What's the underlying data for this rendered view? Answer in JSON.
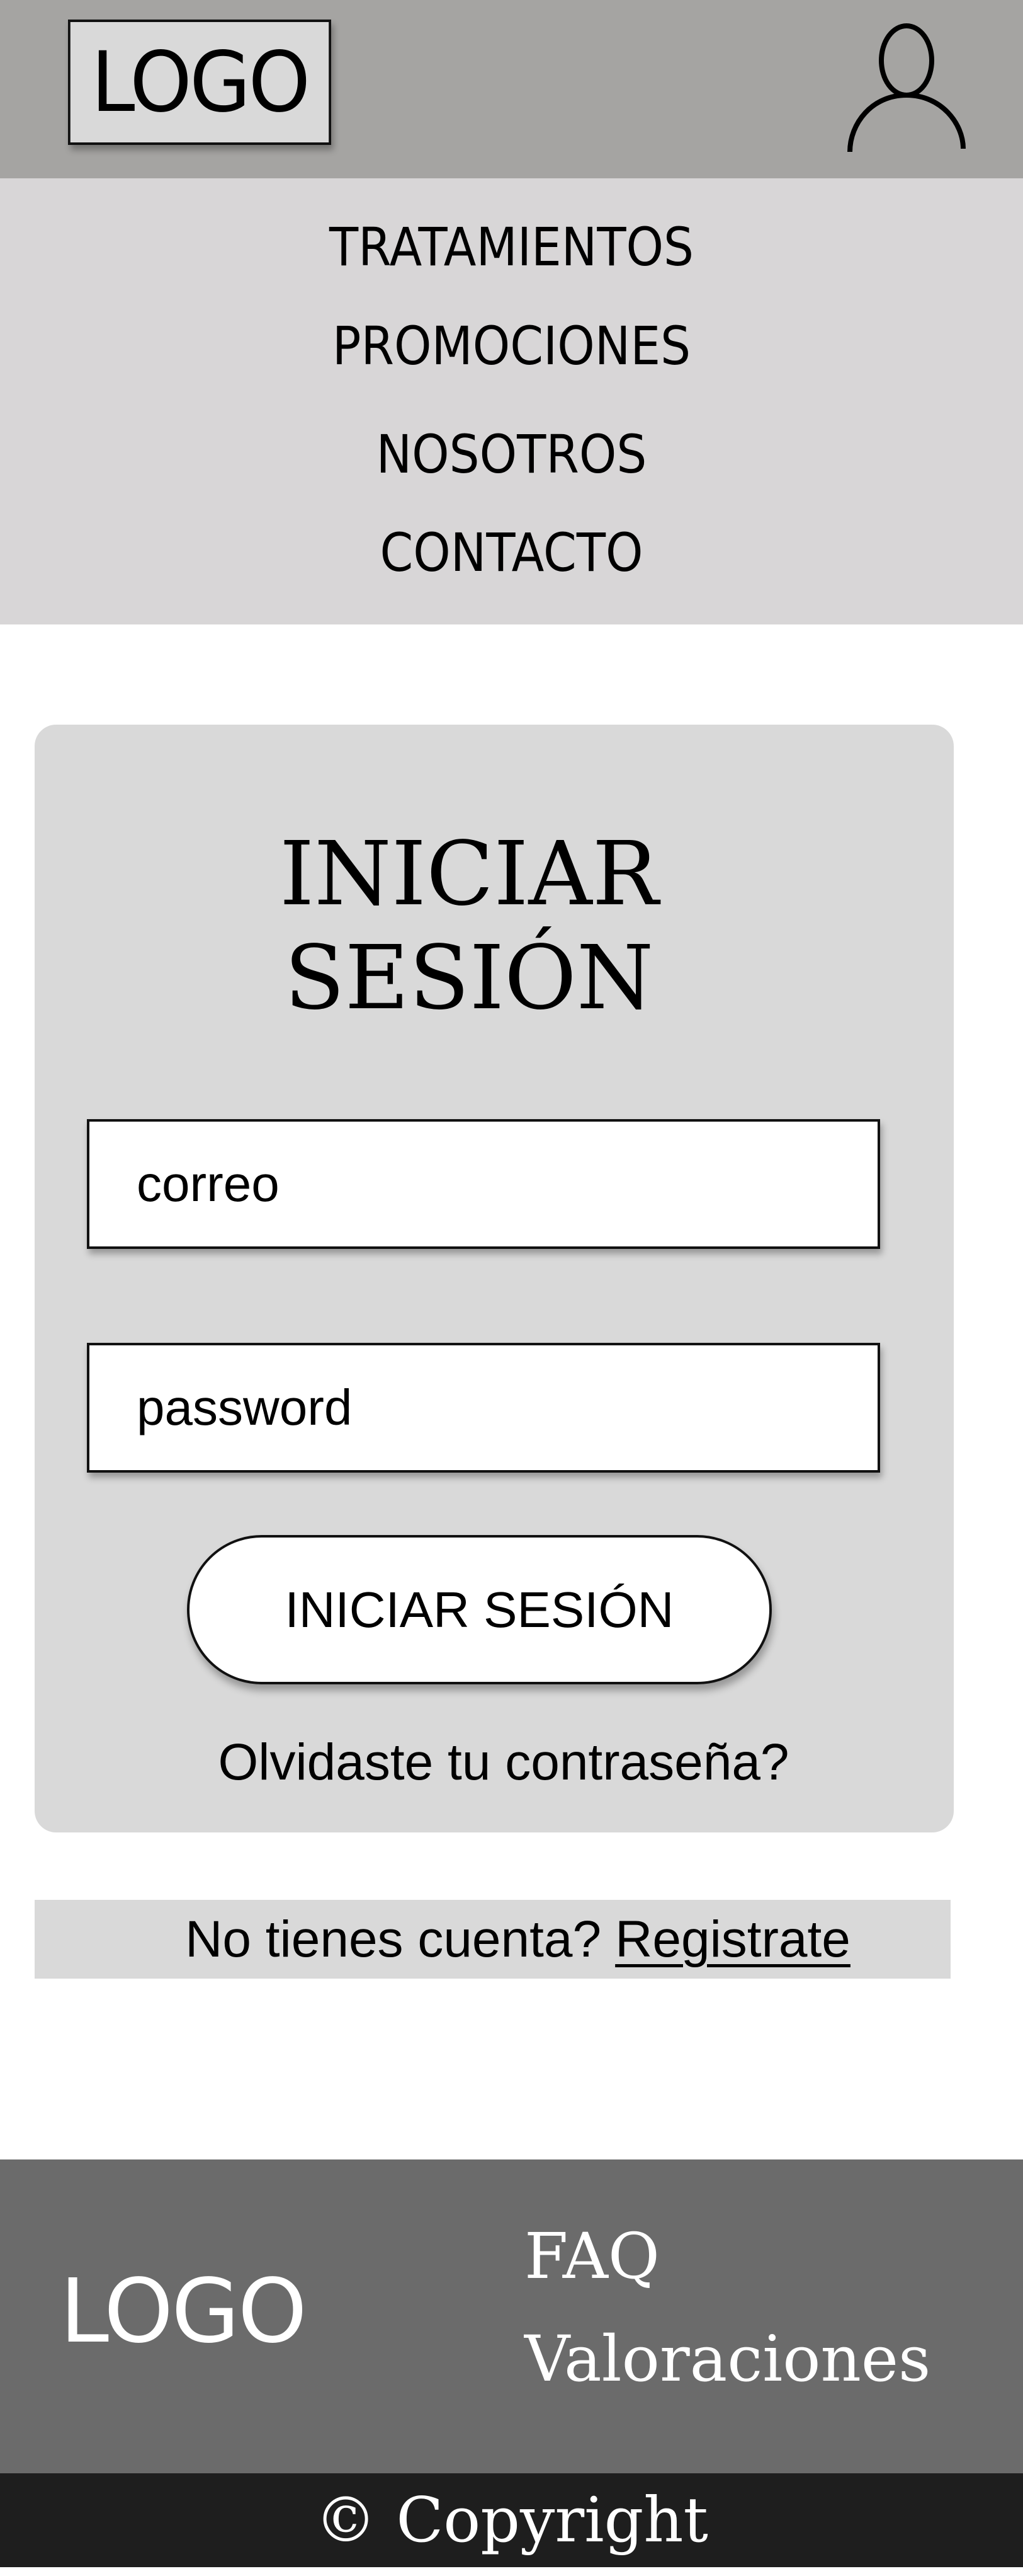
{
  "header": {
    "logo": "LOGO",
    "user_icon": "user-icon"
  },
  "nav": {
    "items": [
      {
        "label": "TRATAMIENTOS"
      },
      {
        "label": "PROMOCIONES"
      },
      {
        "label": "NOSOTROS"
      },
      {
        "label": "CONTACTO"
      }
    ]
  },
  "login": {
    "title_line1": "INICIAR",
    "title_line2": "SESIÓN",
    "email_placeholder": "correo",
    "password_placeholder": "password",
    "submit_label": "INICIAR SESIÓN",
    "forgot_label": "Olvidaste tu contraseña?"
  },
  "register": {
    "prompt": "No tienes cuenta?",
    "link_label": "Registrate"
  },
  "footer": {
    "logo": "LOGO",
    "links": [
      {
        "label": "FAQ"
      },
      {
        "label": "Valoraciones"
      }
    ],
    "copyright": "© Copyright"
  },
  "colors": {
    "header_bg": "#a5a4a2",
    "nav_bg": "#d8d6d7",
    "card_bg": "#d9d9d9",
    "footer_bg": "#6b6b6b",
    "copyright_bg": "#1e1e1e"
  }
}
